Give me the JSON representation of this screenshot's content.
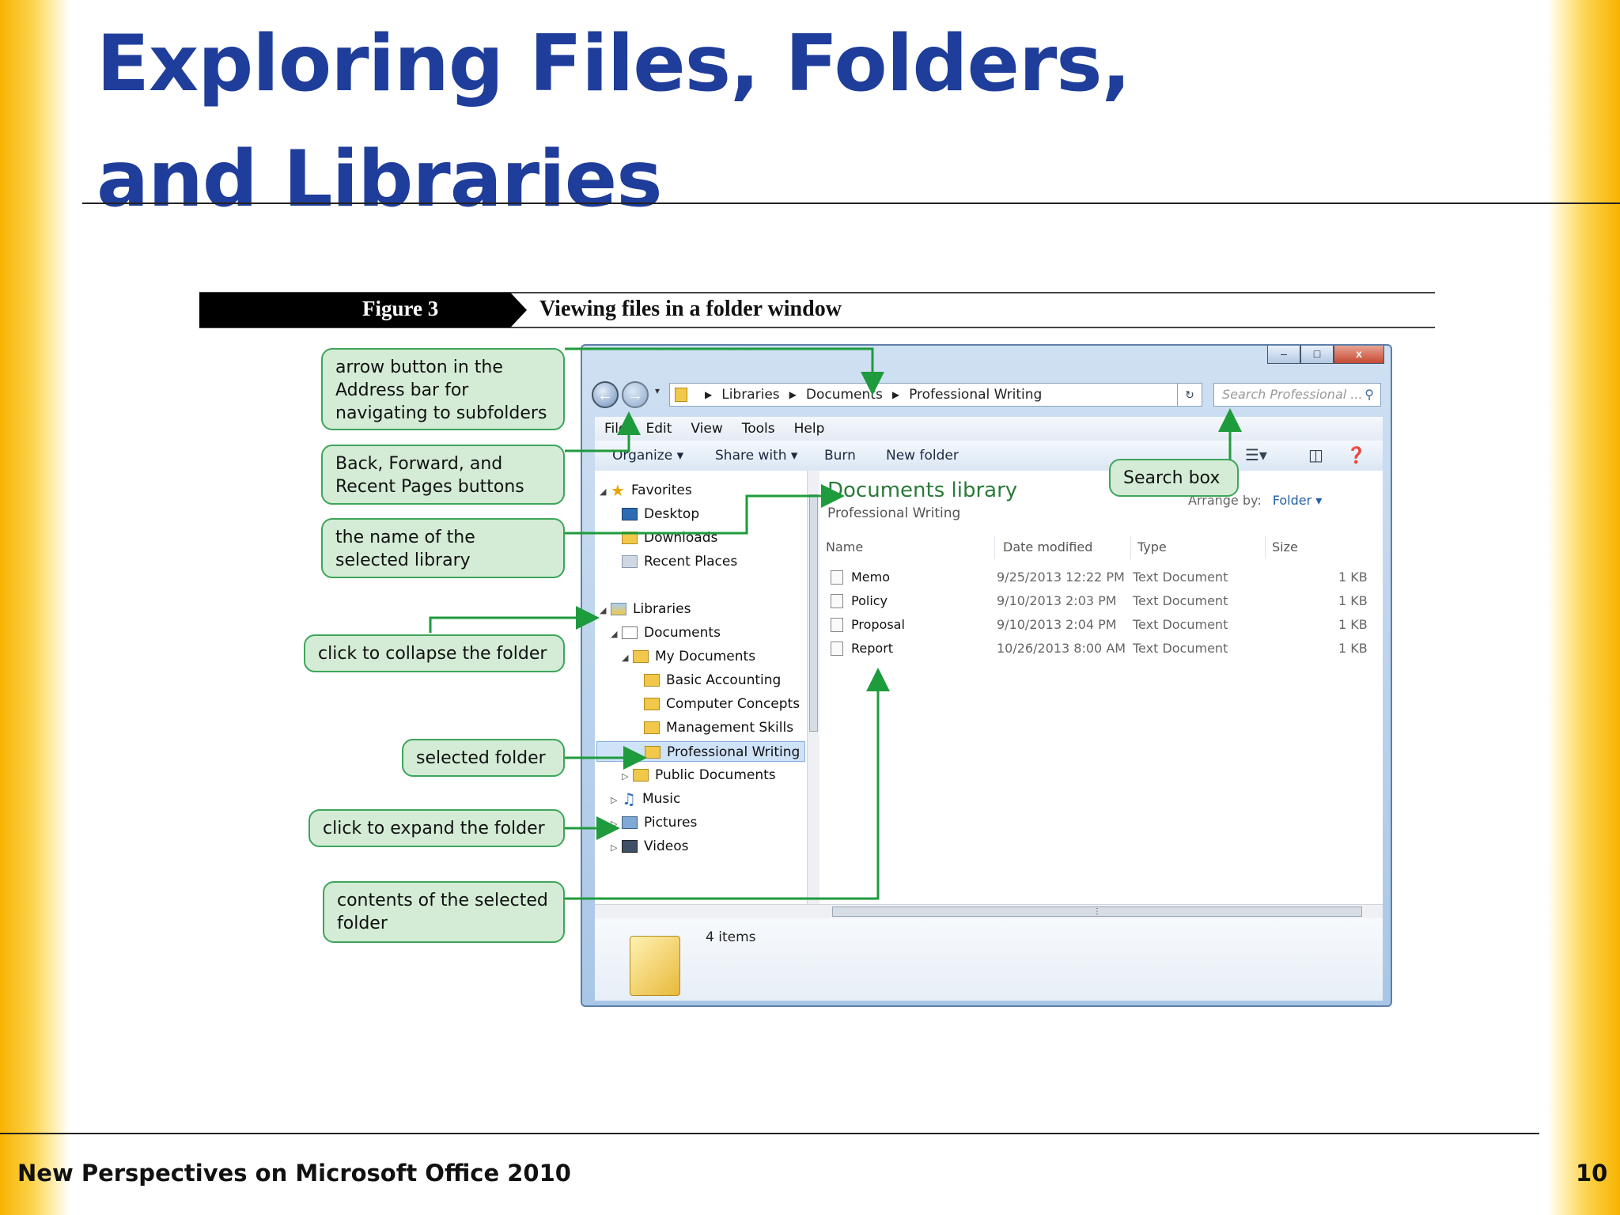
{
  "slide": {
    "title_line1": "Exploring Files, Folders,",
    "title_line2": "and Libraries",
    "footer": "New Perspectives on Microsoft Office 2010",
    "page_number": "10",
    "colors": {
      "title": "#1f3d9a",
      "accent_band": "#f7b300",
      "callout_fill": "#d4ecd6",
      "arrow": "#1e9b3c"
    }
  },
  "figure": {
    "label": "Figure 3",
    "caption": "Viewing files in a folder window"
  },
  "callouts": {
    "arrow_button": "arrow button in the Address bar for navigating to subfolders",
    "back_forward": "Back, Forward, and Recent Pages buttons",
    "library_name": "the name of the selected library",
    "collapse": "click to collapse the folder",
    "selected_folder": "selected folder",
    "expand": "click to expand the folder",
    "contents": "contents of the selected folder",
    "search_box": "Search box"
  },
  "window": {
    "controls": {
      "minimize": "–",
      "maximize": "□",
      "close": "x"
    },
    "address": {
      "seg1": "Libraries",
      "seg2": "Documents",
      "seg3": "Professional Writing"
    },
    "search_placeholder": "Search Professional ...",
    "menu": [
      "File",
      "Edit",
      "View",
      "Tools",
      "Help"
    ],
    "toolbar": {
      "organize": "Organize ▾",
      "share": "Share with ▾",
      "burn": "Burn",
      "new_folder": "New folder"
    },
    "nav": {
      "favorites": "Favorites",
      "desktop": "Desktop",
      "downloads": "Downloads",
      "recent_places": "Recent Places",
      "libraries": "Libraries",
      "documents": "Documents",
      "my_documents": "My Documents",
      "basic_accounting": "Basic Accounting",
      "computer_concepts": "Computer Concepts",
      "management_skills": "Management Skills",
      "professional_writing": "Professional Writing",
      "public_documents": "Public Documents",
      "music": "Music",
      "pictures": "Pictures",
      "videos": "Videos"
    },
    "content": {
      "library_title": "Documents library",
      "library_sub": "Professional Writing",
      "arrange_label": "Arrange by:",
      "arrange_value": "Folder ▾",
      "columns": {
        "name": "Name",
        "date": "Date modified",
        "type": "Type",
        "size": "Size"
      },
      "files": [
        {
          "name": "Memo",
          "date": "9/25/2013 12:22 PM",
          "type": "Text Document",
          "size": "1 KB"
        },
        {
          "name": "Policy",
          "date": "9/10/2013 2:03 PM",
          "type": "Text Document",
          "size": "1 KB"
        },
        {
          "name": "Proposal",
          "date": "9/10/2013 2:04 PM",
          "type": "Text Document",
          "size": "1 KB"
        },
        {
          "name": "Report",
          "date": "10/26/2013 8:00 AM",
          "type": "Text Document",
          "size": "1 KB"
        }
      ]
    },
    "status": "4 items"
  }
}
